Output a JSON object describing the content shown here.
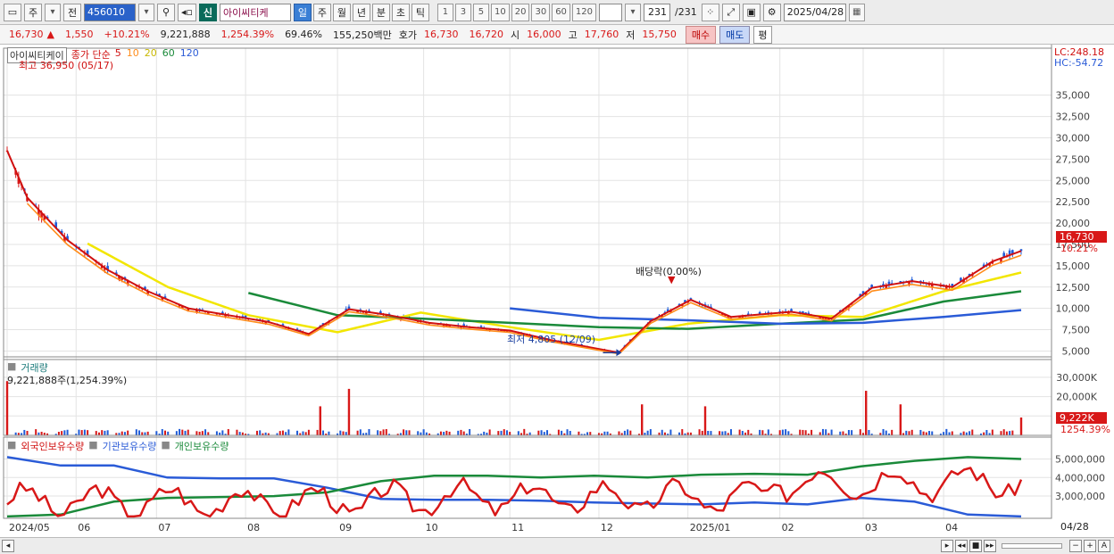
{
  "toolbar": {
    "market": "주",
    "prev_label": "전",
    "code": "456010",
    "badge": "신",
    "stock_name": "아이씨티케",
    "periods": [
      "일",
      "주",
      "월",
      "년",
      "분",
      "초",
      "틱"
    ],
    "active_period": "일",
    "intervals": [
      "1",
      "3",
      "5",
      "10",
      "20",
      "30",
      "60",
      "120"
    ],
    "page_count": "231",
    "page_total": "/231",
    "date": "2025/04/28"
  },
  "quote": {
    "price": "16,730",
    "change": "1,550",
    "change_pct": "+10.21%",
    "volume": "9,221,888",
    "volume_pct": "1,254.39%",
    "turnover": "69.46%",
    "amount": "155,250백만",
    "ask_label": "호가",
    "ask1": "16,730",
    "ask2": "16,720",
    "open_label": "시",
    "open": "16,000",
    "high_label": "고",
    "high": "17,760",
    "low_label": "저",
    "low": "15,750",
    "buy_label": "매수",
    "sell_label": "매도",
    "avg_label": "평"
  },
  "legend": {
    "stock": "아이씨티케이",
    "ma_title": "종가 단순",
    "ma_periods": [
      "5",
      "10",
      "20",
      "60",
      "120"
    ],
    "ma_colors": [
      "#d01010",
      "#ff8c1a",
      "#f2e600",
      "#1a8a3a",
      "#2a5bd7"
    ],
    "volume_title": "거래량",
    "volume_value": "9,221,888주(1,254.39%)",
    "holding_series": [
      "외국인보유수량",
      "기관보유수량",
      "개인보유수량"
    ]
  },
  "annotations": {
    "high": "최고 36,950 (05/17)",
    "low": "최저 4,805 (12/09)",
    "dividend": "배당락(0.00%)",
    "lc": "LC:248.18",
    "hc": "HC:-54.72",
    "price_tag": "16,730",
    "price_pct": "10.21%",
    "vol_tag": "9,222K",
    "vol_pct": "1254.39%",
    "hold_date": "04/28"
  },
  "axes": {
    "price_ticks": [
      "35,000",
      "32,500",
      "30,000",
      "27,500",
      "25,000",
      "22,500",
      "20,000",
      "17,500",
      "15,000",
      "12,500",
      "10,000",
      "7,500",
      "5,000"
    ],
    "volume_ticks": [
      "30,000K",
      "20,000K",
      "10,000K"
    ],
    "hold_ticks": [
      "5,000,000",
      "4,000,000",
      "3,000,000"
    ],
    "x_labels": [
      "2024/05",
      "06",
      "07",
      "08",
      "09",
      "10",
      "11",
      "12",
      "2025/01",
      "02",
      "03",
      "04"
    ]
  },
  "chart_data": {
    "type": "candlestick",
    "price_ylim": [
      4000,
      38000
    ],
    "volume_ylim": [
      0,
      35000
    ],
    "close_series": [
      {
        "date": "2024/05/10",
        "value": 28500
      },
      {
        "date": "2024/05/17",
        "value": 23000
      },
      {
        "date": "2024/05/31",
        "value": 18000
      },
      {
        "date": "2024/06/14",
        "value": 14500
      },
      {
        "date": "2024/06/28",
        "value": 12000
      },
      {
        "date": "2024/07/12",
        "value": 10000
      },
      {
        "date": "2024/07/26",
        "value": 9200
      },
      {
        "date": "2024/08/09",
        "value": 8400
      },
      {
        "date": "2024/08/23",
        "value": 7000
      },
      {
        "date": "2024/09/06",
        "value": 9900
      },
      {
        "date": "2024/09/20",
        "value": 9200
      },
      {
        "date": "2024/10/04",
        "value": 8300
      },
      {
        "date": "2024/10/18",
        "value": 7800
      },
      {
        "date": "2024/11/01",
        "value": 7400
      },
      {
        "date": "2024/11/15",
        "value": 6300
      },
      {
        "date": "2024/12/09",
        "value": 4805
      },
      {
        "date": "2024/12/20",
        "value": 8500
      },
      {
        "date": "2025/01/03",
        "value": 11000
      },
      {
        "date": "2025/01/17",
        "value": 9000
      },
      {
        "date": "2025/02/07",
        "value": 9600
      },
      {
        "date": "2025/02/21",
        "value": 8800
      },
      {
        "date": "2025/03/07",
        "value": 12400
      },
      {
        "date": "2025/03/21",
        "value": 13200
      },
      {
        "date": "2025/04/04",
        "value": 12500
      },
      {
        "date": "2025/04/18",
        "value": 15500
      },
      {
        "date": "2025/04/28",
        "value": 16730
      }
    ],
    "ma_series": [
      {
        "name": "20",
        "values": [
          {
            "date": "2024/06/07",
            "value": 17600
          },
          {
            "date": "2024/07/05",
            "value": 12500
          },
          {
            "date": "2024/08/02",
            "value": 9200
          },
          {
            "date": "2024/09/02",
            "value": 7200
          },
          {
            "date": "2024/10/01",
            "value": 9500
          },
          {
            "date": "2024/11/01",
            "value": 7800
          },
          {
            "date": "2024/12/02",
            "value": 6300
          },
          {
            "date": "2025/01/02",
            "value": 8200
          },
          {
            "date": "2025/02/03",
            "value": 9200
          },
          {
            "date": "2025/03/04",
            "value": 9000
          },
          {
            "date": "2025/04/01",
            "value": 12000
          },
          {
            "date": "2025/04/28",
            "value": 14200
          }
        ]
      },
      {
        "name": "60",
        "values": [
          {
            "date": "2024/08/02",
            "value": 11800
          },
          {
            "date": "2024/09/02",
            "value": 9200
          },
          {
            "date": "2024/10/01",
            "value": 8800
          },
          {
            "date": "2024/11/01",
            "value": 8300
          },
          {
            "date": "2024/12/02",
            "value": 7800
          },
          {
            "date": "2025/01/02",
            "value": 7600
          },
          {
            "date": "2025/02/03",
            "value": 8200
          },
          {
            "date": "2025/03/04",
            "value": 8700
          },
          {
            "date": "2025/04/01",
            "value": 10800
          },
          {
            "date": "2025/04/28",
            "value": 12000
          }
        ]
      },
      {
        "name": "120",
        "values": [
          {
            "date": "2024/11/01",
            "value": 10000
          },
          {
            "date": "2024/12/02",
            "value": 8900
          },
          {
            "date": "2025/01/02",
            "value": 8600
          },
          {
            "date": "2025/02/03",
            "value": 8200
          },
          {
            "date": "2025/03/04",
            "value": 8300
          },
          {
            "date": "2025/04/01",
            "value": 9000
          },
          {
            "date": "2025/04/28",
            "value": 9800
          }
        ]
      }
    ],
    "volume": [
      {
        "date": "2024/05/10",
        "value": 28000
      },
      {
        "date": "2024/08/27",
        "value": 15000
      },
      {
        "date": "2024/09/06",
        "value": 24000
      },
      {
        "date": "2024/12/17",
        "value": 16000
      },
      {
        "date": "2025/01/08",
        "value": 15000
      },
      {
        "date": "2025/03/05",
        "value": 23000
      },
      {
        "date": "2025/03/17",
        "value": 16000
      },
      {
        "date": "2025/04/28",
        "value": 9222
      }
    ]
  }
}
